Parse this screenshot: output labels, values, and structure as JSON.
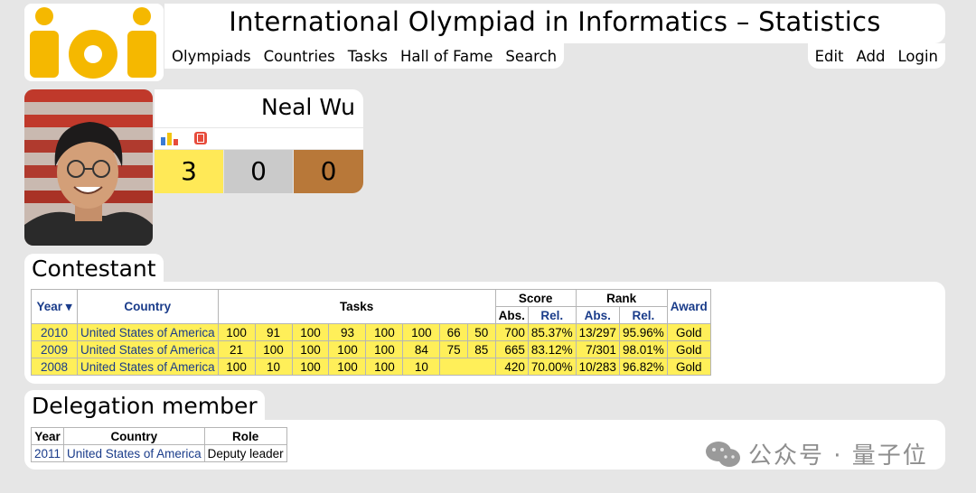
{
  "header": {
    "logo_text": "ioi",
    "title": "International Olympiad in Informatics – Statistics"
  },
  "nav": {
    "left": [
      "Olympiads",
      "Countries",
      "Tasks",
      "Hall of Fame",
      "Search"
    ],
    "right": [
      "Edit",
      "Add",
      "Login"
    ]
  },
  "profile": {
    "name": "Neal Wu",
    "icons": [
      "chart-icon",
      "flag-icon"
    ],
    "medals": {
      "gold": "3",
      "silver": "0",
      "bronze": "0"
    }
  },
  "contestant": {
    "title": "Contestant",
    "headers": {
      "year": "Year ▾",
      "country": "Country",
      "tasks": "Tasks",
      "score": "Score",
      "rank": "Rank",
      "award": "Award",
      "abs": "Abs.",
      "rel": "Rel."
    },
    "rows": [
      {
        "year": "2010",
        "country": "United States of America",
        "tasks": [
          "100",
          "91",
          "100",
          "93",
          "100",
          "100",
          "66",
          "50"
        ],
        "score_abs": "700",
        "score_rel": "85.37%",
        "rank_abs": "13/297",
        "rank_rel": "95.96%",
        "award": "Gold"
      },
      {
        "year": "2009",
        "country": "United States of America",
        "tasks": [
          "21",
          "100",
          "100",
          "100",
          "100",
          "84",
          "75",
          "85"
        ],
        "score_abs": "665",
        "score_rel": "83.12%",
        "rank_abs": "7/301",
        "rank_rel": "98.01%",
        "award": "Gold"
      },
      {
        "year": "2008",
        "country": "United States of America",
        "tasks": [
          "100",
          "10",
          "100",
          "100",
          "100",
          "10",
          "",
          ""
        ],
        "score_abs": "420",
        "score_rel": "70.00%",
        "rank_abs": "10/283",
        "rank_rel": "96.82%",
        "award": "Gold"
      }
    ]
  },
  "delegation": {
    "title": "Delegation member",
    "headers": {
      "year": "Year",
      "country": "Country",
      "role": "Role"
    },
    "rows": [
      {
        "year": "2011",
        "country": "United States of America",
        "role": "Deputy leader"
      }
    ]
  },
  "watermark": {
    "text": "公众号 · 量子位"
  },
  "colors": {
    "gold": "#ffe957",
    "silver": "#cacaca",
    "bronze": "#b87839",
    "link": "#1a3c8a",
    "row": "#ffef59"
  }
}
